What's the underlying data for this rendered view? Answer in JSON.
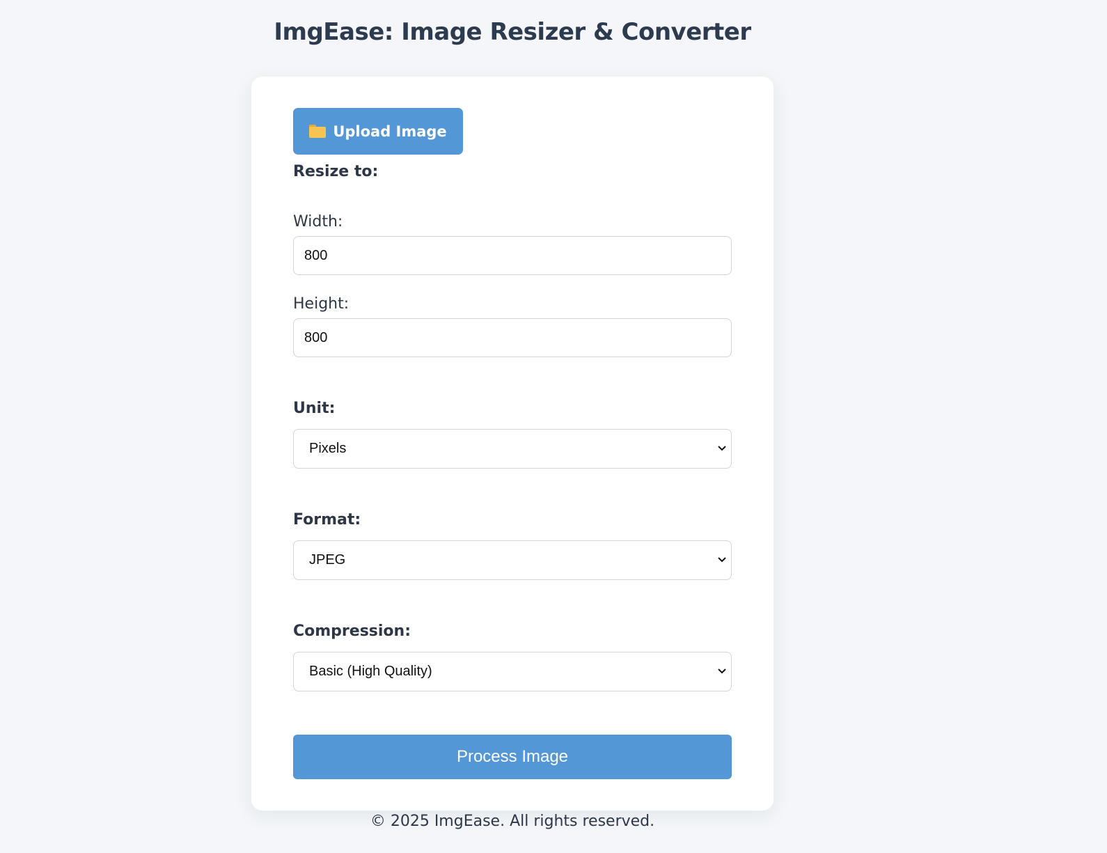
{
  "header": {
    "title": "ImgEase: Image Resizer & Converter"
  },
  "upload": {
    "label": "Upload Image",
    "icon": "folder-icon"
  },
  "resize": {
    "heading": "Resize to:",
    "width_label": "Width:",
    "width_value": "800",
    "height_label": "Height:",
    "height_value": "800"
  },
  "unit": {
    "label": "Unit:",
    "selected": "Pixels"
  },
  "format": {
    "label": "Format:",
    "selected": "JPEG"
  },
  "compression": {
    "label": "Compression:",
    "selected": "Basic (High Quality)"
  },
  "actions": {
    "process_label": "Process Image"
  },
  "footer": {
    "text": "© 2025 ImgEase. All rights reserved."
  },
  "colors": {
    "accent": "#5497d6",
    "background": "#f4f6f9",
    "card": "#ffffff",
    "title_text": "#2d3b4f"
  }
}
